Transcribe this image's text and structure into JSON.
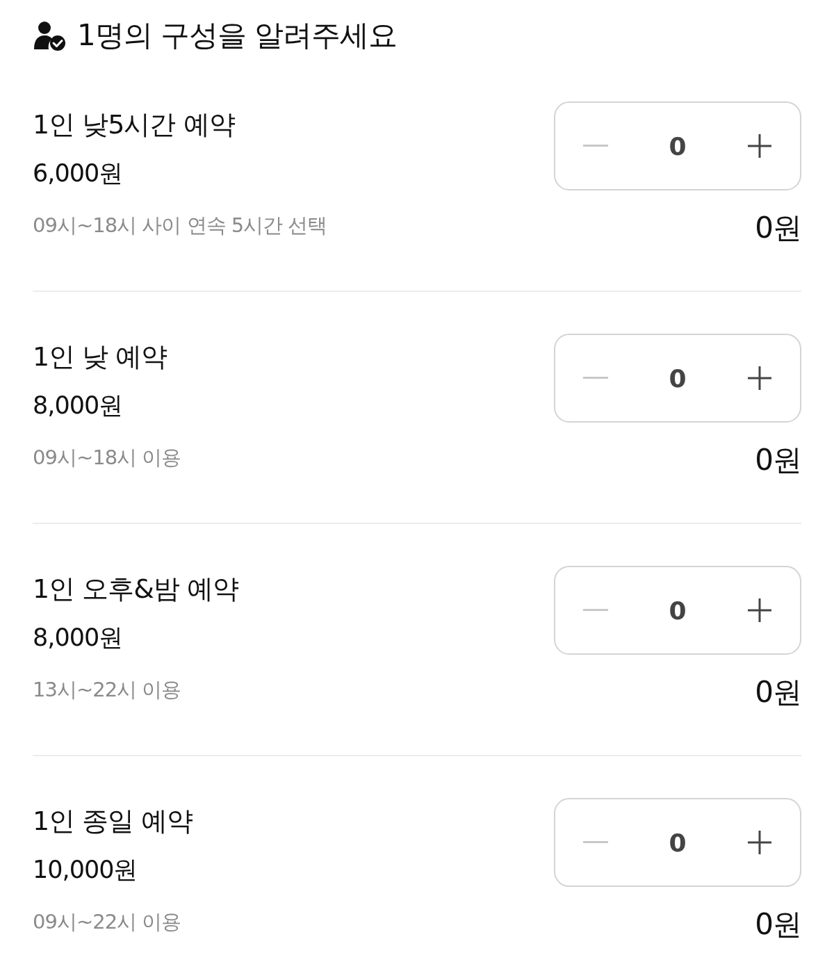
{
  "heading": "1명의 구성을 알려주세요",
  "options": [
    {
      "title": "1인 낮5시간 예약",
      "price": "6,000원",
      "note": "09시~18시 사이 연속 5시간 선택",
      "count": "0",
      "decrement_disabled": true,
      "total": "0원"
    },
    {
      "title": "1인 낮 예약",
      "price": "8,000원",
      "note": "09시~18시 이용",
      "count": "0",
      "decrement_disabled": true,
      "total": "0원"
    },
    {
      "title": "1인 오후&밤 예약",
      "price": "8,000원",
      "note": "13시~22시 이용",
      "count": "0",
      "decrement_disabled": true,
      "total": "0원"
    },
    {
      "title": "1인 종일 예약",
      "price": "10,000원",
      "note": "09시~22시 이용",
      "count": "0",
      "decrement_disabled": true,
      "total": "0원"
    }
  ]
}
